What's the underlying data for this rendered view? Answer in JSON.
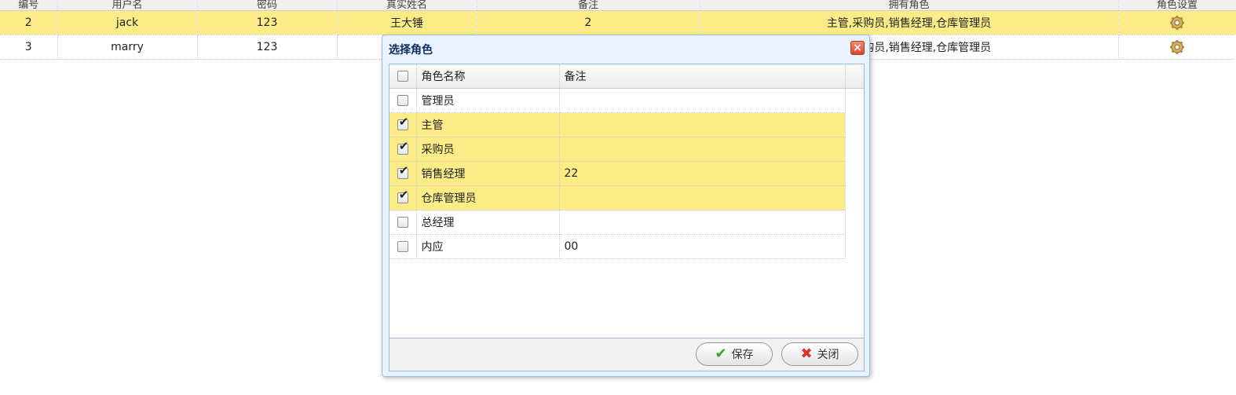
{
  "grid": {
    "headers": [
      "编号",
      "用户名",
      "密码",
      "真实姓名",
      "备注",
      "拥有角色",
      "角色设置"
    ],
    "rows": [
      {
        "id": "2",
        "username": "jack",
        "password": "123",
        "realname": "王大锤",
        "remark": "2",
        "roles": "主管,采购员,销售经理,仓库管理员",
        "selected": true
      },
      {
        "id": "3",
        "username": "marry",
        "password": "123",
        "realname": "",
        "remark": "",
        "roles": "主管,采购员,销售经理,仓库管理员",
        "selected": false
      }
    ],
    "settings_icon": "gear-icon"
  },
  "dialog": {
    "title": "选择角色",
    "columns": {
      "name": "角色名称",
      "remark": "备注"
    },
    "roles": [
      {
        "name": "管理员",
        "remark": "",
        "checked": false
      },
      {
        "name": "主管",
        "remark": "",
        "checked": true
      },
      {
        "name": "采购员",
        "remark": "",
        "checked": true
      },
      {
        "name": "销售经理",
        "remark": "22",
        "checked": true
      },
      {
        "name": "仓库管理员",
        "remark": "",
        "checked": true
      },
      {
        "name": "总经理",
        "remark": "",
        "checked": false
      },
      {
        "name": "内应",
        "remark": "00",
        "checked": false
      }
    ],
    "save_label": "保存",
    "close_label": "关闭"
  },
  "colors": {
    "selected_row": "#fbec88",
    "dialog_border": "#99bbe8",
    "title_text": "#0e2d5f"
  }
}
